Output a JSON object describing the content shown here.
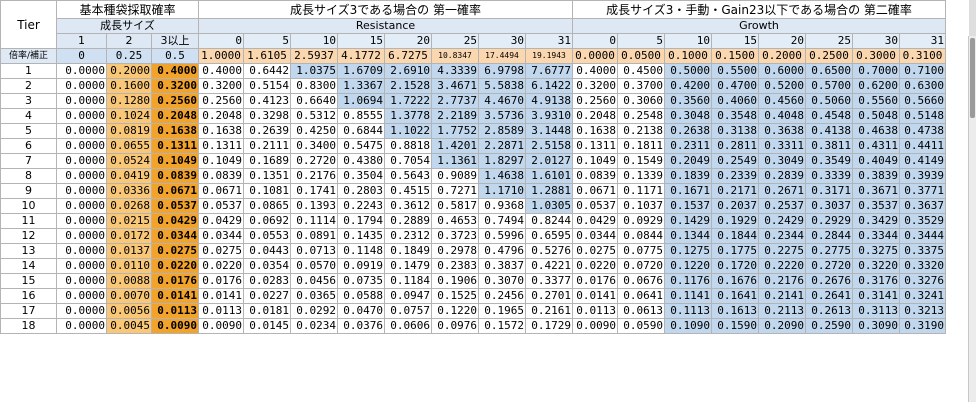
{
  "header": {
    "tier": "Tier",
    "g1_title": "基本種袋採取確率",
    "g1_sub": "成長サイズ",
    "g2_title": "成長サイズ3である場合の 第一確率",
    "g2_sub": "Resistance",
    "g3_title": "成長サイズ3・手動・Gain23以下である場合の 第二確率",
    "g3_sub": "Growth",
    "rowlabel": "倍率/補正"
  },
  "g1_cols": [
    "1",
    "2",
    "3以上"
  ],
  "g1_coef": [
    "0",
    "0.25",
    "0.5"
  ],
  "res_cols": [
    "0",
    "5",
    "10",
    "15",
    "20",
    "25",
    "30",
    "31"
  ],
  "res_coef": [
    "1.0000",
    "1.6105",
    "2.5937",
    "4.1772",
    "6.7275",
    "10.8347",
    "17.4494",
    "19.1943"
  ],
  "gro_cols": [
    "0",
    "5",
    "10",
    "15",
    "20",
    "25",
    "30",
    "31"
  ],
  "gro_coef": [
    "0.0000",
    "0.0500",
    "0.1000",
    "0.1500",
    "0.2000",
    "0.2500",
    "0.3000",
    "0.3100"
  ],
  "rows": [
    {
      "tier": "1",
      "g1": [
        "0.0000",
        "0.2000",
        "0.4000"
      ],
      "res": [
        "0.4000",
        "0.6442",
        "1.0375",
        "1.6709",
        "2.6910",
        "4.3339",
        "6.9798",
        "7.6777"
      ],
      "gro": [
        "0.4000",
        "0.4500",
        "0.5000",
        "0.5500",
        "0.6000",
        "0.6500",
        "0.7000",
        "0.7100"
      ]
    },
    {
      "tier": "2",
      "g1": [
        "0.0000",
        "0.1600",
        "0.3200"
      ],
      "res": [
        "0.3200",
        "0.5154",
        "0.8300",
        "1.3367",
        "2.1528",
        "3.4671",
        "5.5838",
        "6.1422"
      ],
      "gro": [
        "0.3200",
        "0.3700",
        "0.4200",
        "0.4700",
        "0.5200",
        "0.5700",
        "0.6200",
        "0.6300"
      ]
    },
    {
      "tier": "3",
      "g1": [
        "0.0000",
        "0.1280",
        "0.2560"
      ],
      "res": [
        "0.2560",
        "0.4123",
        "0.6640",
        "1.0694",
        "1.7222",
        "2.7737",
        "4.4670",
        "4.9138"
      ],
      "gro": [
        "0.2560",
        "0.3060",
        "0.3560",
        "0.4060",
        "0.4560",
        "0.5060",
        "0.5560",
        "0.5660"
      ]
    },
    {
      "tier": "4",
      "g1": [
        "0.0000",
        "0.1024",
        "0.2048"
      ],
      "res": [
        "0.2048",
        "0.3298",
        "0.5312",
        "0.8555",
        "1.3778",
        "2.2189",
        "3.5736",
        "3.9310"
      ],
      "gro": [
        "0.2048",
        "0.2548",
        "0.3048",
        "0.3548",
        "0.4048",
        "0.4548",
        "0.5048",
        "0.5148"
      ]
    },
    {
      "tier": "5",
      "g1": [
        "0.0000",
        "0.0819",
        "0.1638"
      ],
      "res": [
        "0.1638",
        "0.2639",
        "0.4250",
        "0.6844",
        "1.1022",
        "1.7752",
        "2.8589",
        "3.1448"
      ],
      "gro": [
        "0.1638",
        "0.2138",
        "0.2638",
        "0.3138",
        "0.3638",
        "0.4138",
        "0.4638",
        "0.4738"
      ]
    },
    {
      "tier": "6",
      "g1": [
        "0.0000",
        "0.0655",
        "0.1311"
      ],
      "res": [
        "0.1311",
        "0.2111",
        "0.3400",
        "0.5475",
        "0.8818",
        "1.4201",
        "2.2871",
        "2.5158"
      ],
      "gro": [
        "0.1311",
        "0.1811",
        "0.2311",
        "0.2811",
        "0.3311",
        "0.3811",
        "0.4311",
        "0.4411"
      ]
    },
    {
      "tier": "7",
      "g1": [
        "0.0000",
        "0.0524",
        "0.1049"
      ],
      "res": [
        "0.1049",
        "0.1689",
        "0.2720",
        "0.4380",
        "0.7054",
        "1.1361",
        "1.8297",
        "2.0127"
      ],
      "gro": [
        "0.1049",
        "0.1549",
        "0.2049",
        "0.2549",
        "0.3049",
        "0.3549",
        "0.4049",
        "0.4149"
      ]
    },
    {
      "tier": "8",
      "g1": [
        "0.0000",
        "0.0419",
        "0.0839"
      ],
      "res": [
        "0.0839",
        "0.1351",
        "0.2176",
        "0.3504",
        "0.5643",
        "0.9089",
        "1.4638",
        "1.6101"
      ],
      "gro": [
        "0.0839",
        "0.1339",
        "0.1839",
        "0.2339",
        "0.2839",
        "0.3339",
        "0.3839",
        "0.3939"
      ]
    },
    {
      "tier": "9",
      "g1": [
        "0.0000",
        "0.0336",
        "0.0671"
      ],
      "res": [
        "0.0671",
        "0.1081",
        "0.1741",
        "0.2803",
        "0.4515",
        "0.7271",
        "1.1710",
        "1.2881"
      ],
      "gro": [
        "0.0671",
        "0.1171",
        "0.1671",
        "0.2171",
        "0.2671",
        "0.3171",
        "0.3671",
        "0.3771"
      ]
    },
    {
      "tier": "10",
      "g1": [
        "0.0000",
        "0.0268",
        "0.0537"
      ],
      "res": [
        "0.0537",
        "0.0865",
        "0.1393",
        "0.2243",
        "0.3612",
        "0.5817",
        "0.9368",
        "1.0305"
      ],
      "gro": [
        "0.0537",
        "0.1037",
        "0.1537",
        "0.2037",
        "0.2537",
        "0.3037",
        "0.3537",
        "0.3637"
      ]
    },
    {
      "tier": "11",
      "g1": [
        "0.0000",
        "0.0215",
        "0.0429"
      ],
      "res": [
        "0.0429",
        "0.0692",
        "0.1114",
        "0.1794",
        "0.2889",
        "0.4653",
        "0.7494",
        "0.8244"
      ],
      "gro": [
        "0.0429",
        "0.0929",
        "0.1429",
        "0.1929",
        "0.2429",
        "0.2929",
        "0.3429",
        "0.3529"
      ]
    },
    {
      "tier": "12",
      "g1": [
        "0.0000",
        "0.0172",
        "0.0344"
      ],
      "res": [
        "0.0344",
        "0.0553",
        "0.0891",
        "0.1435",
        "0.2312",
        "0.3723",
        "0.5996",
        "0.6595"
      ],
      "gro": [
        "0.0344",
        "0.0844",
        "0.1344",
        "0.1844",
        "0.2344",
        "0.2844",
        "0.3344",
        "0.3444"
      ]
    },
    {
      "tier": "13",
      "g1": [
        "0.0000",
        "0.0137",
        "0.0275"
      ],
      "res": [
        "0.0275",
        "0.0443",
        "0.0713",
        "0.1148",
        "0.1849",
        "0.2978",
        "0.4796",
        "0.5276"
      ],
      "gro": [
        "0.0275",
        "0.0775",
        "0.1275",
        "0.1775",
        "0.2275",
        "0.2775",
        "0.3275",
        "0.3375"
      ]
    },
    {
      "tier": "14",
      "g1": [
        "0.0000",
        "0.0110",
        "0.0220"
      ],
      "res": [
        "0.0220",
        "0.0354",
        "0.0570",
        "0.0919",
        "0.1479",
        "0.2383",
        "0.3837",
        "0.4221"
      ],
      "gro": [
        "0.0220",
        "0.0720",
        "0.1220",
        "0.1720",
        "0.2220",
        "0.2720",
        "0.3220",
        "0.3320"
      ]
    },
    {
      "tier": "15",
      "g1": [
        "0.0000",
        "0.0088",
        "0.0176"
      ],
      "res": [
        "0.0176",
        "0.0283",
        "0.0456",
        "0.0735",
        "0.1184",
        "0.1906",
        "0.3070",
        "0.3377"
      ],
      "gro": [
        "0.0176",
        "0.0676",
        "0.1176",
        "0.1676",
        "0.2176",
        "0.2676",
        "0.3176",
        "0.3276"
      ]
    },
    {
      "tier": "16",
      "g1": [
        "0.0000",
        "0.0070",
        "0.0141"
      ],
      "res": [
        "0.0141",
        "0.0227",
        "0.0365",
        "0.0588",
        "0.0947",
        "0.1525",
        "0.2456",
        "0.2701"
      ],
      "gro": [
        "0.0141",
        "0.0641",
        "0.1141",
        "0.1641",
        "0.2141",
        "0.2641",
        "0.3141",
        "0.3241"
      ]
    },
    {
      "tier": "17",
      "g1": [
        "0.0000",
        "0.0056",
        "0.0113"
      ],
      "res": [
        "0.0113",
        "0.0181",
        "0.0292",
        "0.0470",
        "0.0757",
        "0.1220",
        "0.1965",
        "0.2161"
      ],
      "gro": [
        "0.0113",
        "0.0613",
        "0.1113",
        "0.1613",
        "0.2113",
        "0.2613",
        "0.3113",
        "0.3213"
      ]
    },
    {
      "tier": "18",
      "g1": [
        "0.0000",
        "0.0045",
        "0.0090"
      ],
      "res": [
        "0.0090",
        "0.0145",
        "0.0234",
        "0.0376",
        "0.0606",
        "0.0976",
        "0.1572",
        "0.1729"
      ],
      "gro": [
        "0.0090",
        "0.0590",
        "0.1090",
        "0.1590",
        "0.2090",
        "0.2590",
        "0.3090",
        "0.3190"
      ]
    }
  ],
  "colors": {
    "orange_light": "#f8c777",
    "orange_bold": "#f2a32b",
    "blue_cell": "#c0d7ee",
    "header_blue": "#dde8f4"
  }
}
